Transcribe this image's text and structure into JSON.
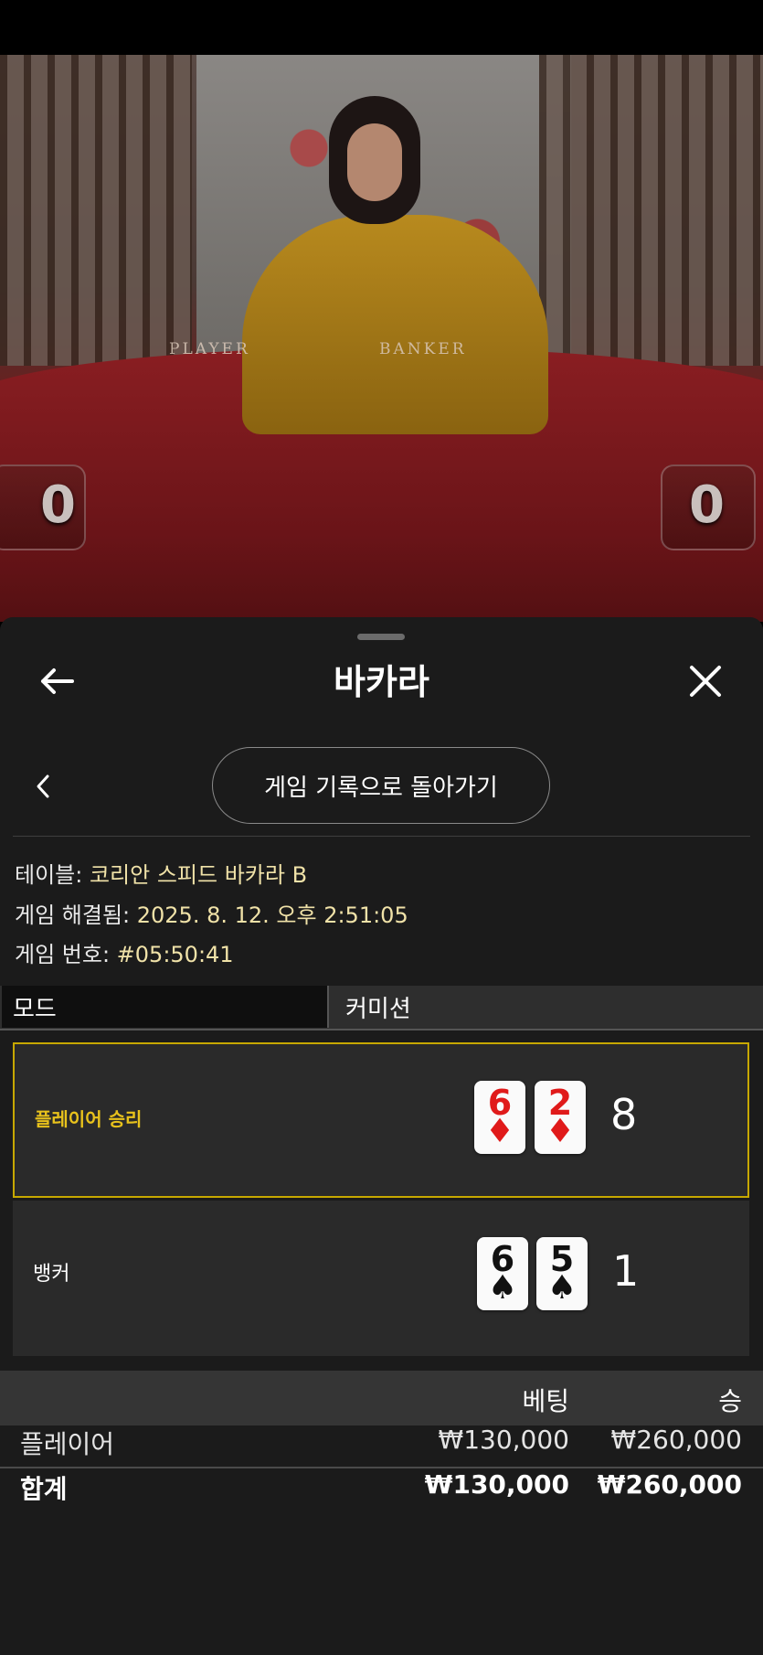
{
  "video": {
    "table_left_text": "PLAYER",
    "table_right_text": "BANKER",
    "player_score": "0",
    "banker_score": "0"
  },
  "panel": {
    "title": "바카라",
    "back_icon": "arrow-left-icon",
    "close_icon": "close-icon",
    "prev_icon": "chevron-left-icon",
    "history_button": "게임 기록으로 돌아가기"
  },
  "info": {
    "table_label": "테이블: ",
    "table_value": "코리안 스피드 바카라 B",
    "resolved_label": "게임 해결됨: ",
    "resolved_value": "2025. 8. 12. 오후 2:51:05",
    "number_label": "게임 번호: ",
    "number_value": "#05:50:41"
  },
  "tabs": {
    "mode": "모드",
    "commission": "커미션"
  },
  "hands": {
    "player": {
      "label": "플레이어 승리",
      "cards": [
        {
          "rank": "6",
          "suit": "♦"
        },
        {
          "rank": "2",
          "suit": "♦"
        }
      ],
      "score": "8"
    },
    "banker": {
      "label": "뱅커",
      "cards": [
        {
          "rank": "6",
          "suit": "♠"
        },
        {
          "rank": "5",
          "suit": "♠"
        }
      ],
      "score": "1"
    }
  },
  "bets": {
    "col_bet": "베팅",
    "col_win": "승",
    "rows": [
      {
        "name": "플레이어",
        "bet": "₩130,000",
        "win": "₩260,000"
      },
      {
        "name": "합계",
        "bet": "₩130,000",
        "win": "₩260,000"
      }
    ]
  },
  "colors": {
    "winner_border": "#c7a800",
    "winner_label": "#e8c21c",
    "info_value": "#f0e2a8",
    "panel_bg": "#1b1b1b"
  }
}
